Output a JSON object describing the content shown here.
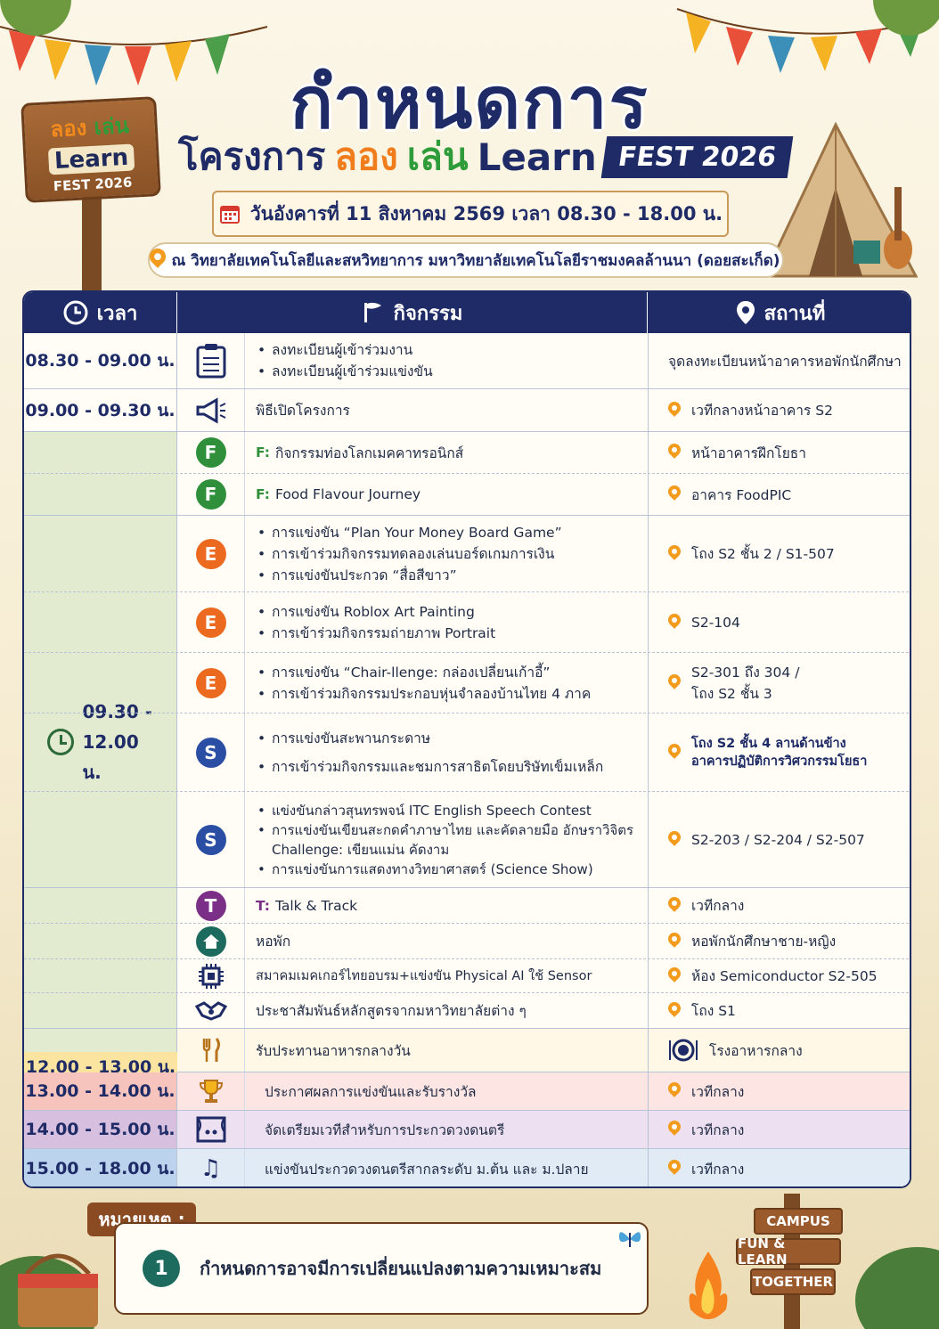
{
  "logo": {
    "line1a": "ลอง",
    "line1b": "เล่น",
    "line2": "Learn",
    "line3": "FEST 2026"
  },
  "title": "กำหนดการ",
  "subtitle": {
    "pre": "โครงการ",
    "w1": "ลอง",
    "w2": "เล่น",
    "w3": "Learn",
    "fest": "FEST 2026"
  },
  "date": "วันอังคารที่ 11 สิงหาคม 2569 เวลา 08.30 - 18.00 น.",
  "venue": "ณ วิทยาลัยเทคโนโลยีและสหวิทยาการ มหาวิทยาลัยเทคโนโลยีราชมงคลล้านนา (ดอยสะเก็ด)",
  "headers": {
    "time": "เวลา",
    "activity": "กิจกรรม",
    "place": "สถานที่"
  },
  "rows": {
    "r1": {
      "time": "08.30 - 09.00 น.",
      "items": [
        "ลงทะเบียนผู้เข้าร่วมงาน",
        "ลงทะเบียนผู้เข้าร่วมแข่งขัน"
      ],
      "place": "จุดลงทะเบียนหน้าอาคารหอพักนักศึกษา"
    },
    "r2": {
      "time": "09.00 - 09.30 น.",
      "activity": "พิธีเปิดโครงการ",
      "place": "เวทีกลางหน้าอาคาร S2"
    },
    "block_time": "09.30 - 12.00 น.",
    "f1": {
      "badge": "F",
      "label": "F:",
      "activity": "กิจกรรมท่องโลกเมคคาทรอนิกส์",
      "place": "หน้าอาคารฝึกโยธา"
    },
    "f2": {
      "badge": "F",
      "label": "F:",
      "activity": "Food Flavour Journey",
      "place": "อาคาร FoodPIC"
    },
    "e1": {
      "badge": "E",
      "items": [
        "การแข่งขัน “Plan Your Money Board Game”",
        "การเข้าร่วมกิจกรรมทดลองเล่นบอร์ดเกมการเงิน",
        "การแข่งขันประกวด “สื่อสีขาว”"
      ],
      "place": "โถง S2 ชั้น 2 / S1-507"
    },
    "e2": {
      "badge": "E",
      "items": [
        "การแข่งขัน Roblox Art Painting",
        "การเข้าร่วมกิจกรรมถ่ายภาพ Portrait"
      ],
      "place": "S2-104"
    },
    "e3": {
      "badge": "E",
      "items": [
        "การแข่งขัน “Chair-llenge: กล่องเปลี่ยนเก้าอี้”",
        "การเข้าร่วมกิจกรรมประกอบหุ่นจำลองบ้านไทย 4 ภาค"
      ],
      "place1": "S2-301 ถึง 304 /",
      "place2": "โถง S2 ชั้น 3"
    },
    "s1": {
      "badge": "S",
      "items": [
        "การแข่งขันสะพานกระดาษ",
        "การเข้าร่วมกิจกรรมและชมการสาธิตโดยบริษัทเข็มเหล็ก"
      ],
      "place1": "โถง S2 ชั้น 4 ลานด้านข้าง",
      "place2": "อาคารปฏิบัติการวิศวกรรมโยธา"
    },
    "s2": {
      "badge": "S",
      "items": [
        "แข่งขันกล่าวสุนทรพจน์ ITC English Speech Contest",
        "การแข่งขันเขียนสะกดคำภาษาไทย และคัดลายมือ อักษราวิจิตร Challenge: เขียนแม่น คัดงาม",
        "การแข่งขันการแสดงทางวิทยาศาสตร์ (Science Show)"
      ],
      "place": "S2-203 / S2-204 / S2-507"
    },
    "t1": {
      "badge": "T",
      "label": "T:",
      "activity": "Talk & Track",
      "place": "เวทีกลาง"
    },
    "h1": {
      "activity": "หอพัก",
      "place": "หอพักนักศึกษาชาย-หญิง"
    },
    "c1": {
      "activity": "สมาคมเมคเกอร์ไทยอบรม+แข่งขัน Physical AI ใช้ Sensor",
      "place": "ห้อง Semiconductor S2-505"
    },
    "p1": {
      "activity": "ประชาสัมพันธ์หลักสูตรจากมหาวิทยาลัยต่าง ๆ",
      "place": "โถง S1"
    },
    "lunch": {
      "time": "12.00 - 13.00 น.",
      "activity": "รับประทานอาหารกลางวัน",
      "place": "โรงอาหารกลาง"
    },
    "award": {
      "time": "13.00 - 14.00 น.",
      "activity": "ประกาศผลการแข่งขันและรับรางวัล",
      "place": "เวทีกลาง"
    },
    "prep": {
      "time": "14.00 - 15.00 น.",
      "activity": "จัดเตรียมเวทีสำหรับการประกวดวงดนตรี",
      "place": "เวทีกลาง"
    },
    "band": {
      "time": "15.00 - 18.00 น.",
      "activity": "แข่งขันประกวดวงดนตรีสากลระดับ ม.ต้น และ ม.ปลาย",
      "place": "เวทีกลาง"
    }
  },
  "note": {
    "tag": "หมายเหตุ :",
    "num": "1",
    "text": "กำหนดการอาจมีการเปลี่ยนแปลงตามความเหมาะสม"
  },
  "signs": {
    "s1": "CAMPUS",
    "s2": "FUN & LEARN",
    "s3": "TOGETHER"
  },
  "colors": {
    "navy": "#1e2b66",
    "green": "#2f9c3a",
    "orange": "#f07c1c",
    "blue": "#2a4ea3",
    "purple": "#7b2f86",
    "teal": "#1d6b5e"
  }
}
